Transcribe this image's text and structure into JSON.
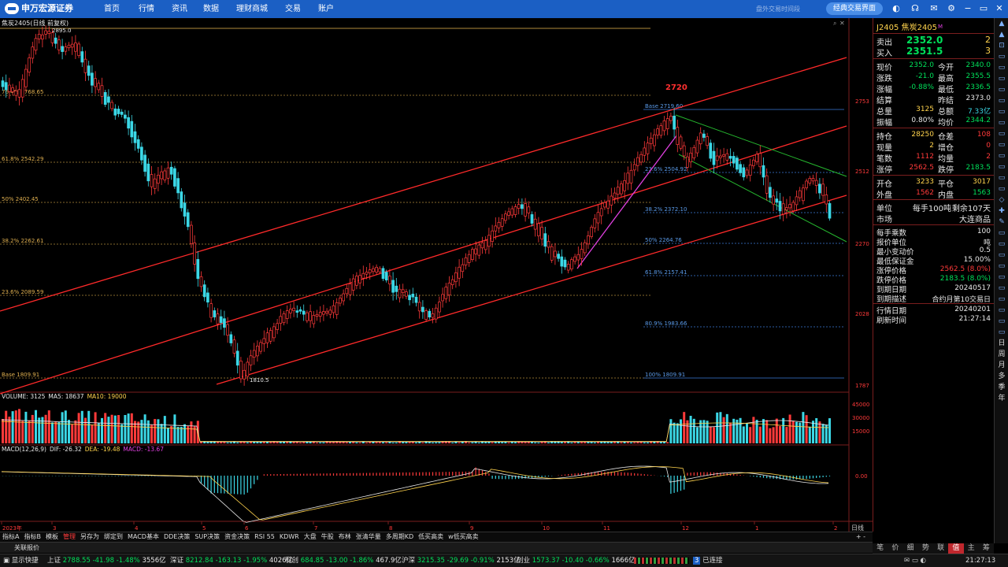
{
  "app": {
    "logo_text": "申万宏源证券",
    "top_hint": "盘外交易时间段",
    "classic_button": "经典交易界面"
  },
  "nav": [
    "首页",
    "行情",
    "资讯",
    "数据",
    "理财商城",
    "交易",
    "账户"
  ],
  "chart": {
    "title": "焦炭2405(日线 前复权)",
    "price_axis": [
      "2753",
      "2512",
      "2270",
      "2028",
      "1787"
    ],
    "volume_axis": [
      "45000",
      "30000",
      "15000"
    ],
    "macd_axis": [
      "0.00"
    ],
    "x_axis": [
      "2023年",
      "3",
      "4",
      "5",
      "6",
      "7",
      "8",
      "9",
      "10",
      "11",
      "12",
      "1",
      "2"
    ],
    "period": "日线",
    "fib_left": [
      "76.4% 2768.65",
      "61.8% 2542.29",
      "50% 2402.45",
      "38.2% 2262.61",
      "23.6% 2089.59",
      "Base 1809.91"
    ],
    "fib_right": [
      "Base 2719.60",
      "23.6% 2504.92",
      "38.2% 2372.10",
      "50% 2264.76",
      "61.8% 2157.41",
      "80.9% 1983.66",
      "100% 1809.91"
    ],
    "high_label": "2895.0",
    "low_label": "1810.5",
    "annotation": "2720",
    "volume_legend": {
      "vol": "VOLUME: 3125",
      "ma5": "MA5: 18637",
      "ma10": "MA10: 19000"
    },
    "macd_legend": {
      "macd": "MACD(12,26,9)",
      "dif": "DIF: -26.32",
      "dea": "DEA: -19.48",
      "m": "MACD: -13.67"
    }
  },
  "quote": {
    "contract": "J2405 焦炭2405",
    "sell": {
      "label": "卖出",
      "price": "2352.0",
      "qty": "2"
    },
    "buy": {
      "label": "买入",
      "price": "2351.5",
      "qty": "3"
    },
    "rows1": [
      [
        "现价",
        "2352.0",
        "今开",
        "2340.0"
      ],
      [
        "涨跌",
        "-21.0",
        "最高",
        "2355.5"
      ],
      [
        "涨幅",
        "-0.88%",
        "最低",
        "2336.5"
      ],
      [
        "结算",
        "",
        "昨结",
        "2373.0"
      ],
      [
        "总量",
        "3125",
        "总额",
        "7.33亿"
      ],
      [
        "振幅",
        "0.80%",
        "均价",
        "2344.2"
      ]
    ],
    "rows2": [
      [
        "持仓",
        "28250",
        "仓差",
        "108"
      ],
      [
        "现量",
        "2",
        "增仓",
        "0"
      ],
      [
        "笔数",
        "1112",
        "均量",
        "2"
      ],
      [
        "涨停",
        "2562.5",
        "跌停",
        "2183.5"
      ]
    ],
    "rows3": [
      [
        "开仓",
        "3233",
        "平仓",
        "3017"
      ],
      [
        "外盘",
        "1562",
        "内盘",
        "1563"
      ]
    ],
    "unit": {
      "label": "单位",
      "value": "每手100吨",
      "remain": "剩余107天"
    },
    "market": {
      "label": "市场",
      "value": "大连商品"
    },
    "info": [
      [
        "每手乘数",
        "100"
      ],
      [
        "报价单位",
        "吨"
      ],
      [
        "最小变动价",
        "0.5"
      ],
      [
        "最低保证金",
        "15.00%"
      ],
      [
        "涨停价格",
        "2562.5 (8.0%)"
      ],
      [
        "跌停价格",
        "2183.5 (8.0%)"
      ],
      [
        "到期日期",
        "20240517"
      ],
      [
        "到期描述",
        "合约月第10交易日"
      ]
    ],
    "dates": [
      [
        "行情日期",
        "20240201"
      ],
      [
        "刷新时间",
        "21:27:14"
      ]
    ]
  },
  "right_tools": [
    "▲",
    "▲",
    "⊡",
    "▭",
    "▭",
    "▭",
    "▭",
    "▭",
    "▭",
    "▭",
    "▭",
    "▭",
    "▭",
    "▭",
    "▭",
    "▭",
    "◇",
    "✚",
    "✎",
    "▭",
    "▭",
    "▭",
    "▭",
    "▭",
    "▭",
    "▭",
    "▭",
    "▭",
    "▭",
    "日",
    "周",
    "月",
    "多",
    "季",
    "年"
  ],
  "indicator_tabs": [
    "指标A",
    "指标B",
    "模板",
    "管理",
    "另存为",
    "绑定到",
    "MACD基本",
    "DDE决策",
    "SUP决策",
    "资金决策",
    "RSI 55",
    "KDWR",
    "大盘",
    "牛股",
    "布林",
    "张清华量",
    "多周期KD",
    "低买高卖",
    "w低买高卖"
  ],
  "quick_tab": "关联报价",
  "bottom_tabs": [
    "笔",
    "价",
    "细",
    "势",
    "联",
    "值",
    "主",
    "筹"
  ],
  "status": {
    "sh": {
      "name": "上证",
      "v": "2788.55",
      "c": "-41.98",
      "p": "-1.48%",
      "a": "3556亿"
    },
    "sz": {
      "name": "深证",
      "v": "8212.84",
      "c": "-163.13",
      "p": "-1.95%",
      "a": "4026亿"
    },
    "kc": {
      "name": "科创",
      "v": "684.85",
      "c": "-13.00",
      "p": "-1.86%",
      "a": "467.9亿"
    },
    "hs": {
      "name": "沪深",
      "v": "3215.35",
      "c": "-29.69",
      "p": "-0.91%",
      "a": "2153亿"
    },
    "cy": {
      "name": "创业",
      "v": "1573.37",
      "c": "-10.40",
      "p": "-0.66%",
      "a": "1666亿"
    },
    "left": "显示快捷",
    "conn": "已连接",
    "time": "21:27:13"
  }
}
